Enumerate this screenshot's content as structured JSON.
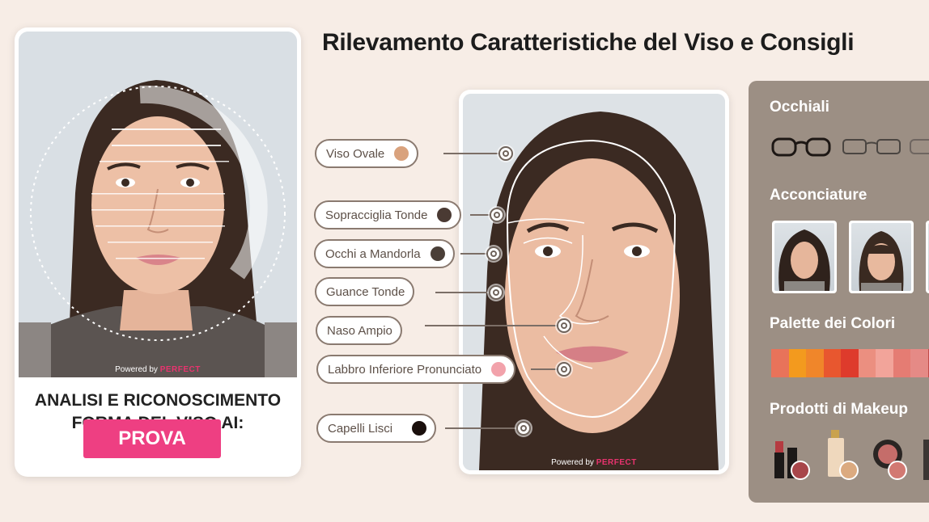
{
  "title": "Rilevamento Caratteristiche del Viso e Consigli",
  "left_card": {
    "heading_line1": "ANALISI E RICONOSCIMENTO",
    "heading_line2": "FORMA DEL VISO AI:",
    "cta_label": "PROVA",
    "powered_prefix": "Powered by",
    "powered_brand": "PERFECT"
  },
  "features": [
    {
      "label": "Viso Ovale",
      "color": "#d9a27d"
    },
    {
      "label": "Sopracciglia Tonde",
      "color": "#4a3a33"
    },
    {
      "label": "Occhi a Mandorla",
      "color": "#4a3f38"
    },
    {
      "label": "Guance Tonde",
      "color": ""
    },
    {
      "label": "Naso Ampio",
      "color": ""
    },
    {
      "label": "Labbro Inferiore Pronunciato",
      "color": "#f2a2ab"
    },
    {
      "label": "Capelli Lisci",
      "color": "#1a0f0c"
    }
  ],
  "center_photo": {
    "powered_prefix": "Powered by",
    "powered_brand": "PERFECT"
  },
  "panel": {
    "glasses_title": "Occhiali",
    "hair_title": "Acconciature",
    "palette_title": "Palette dei Colori",
    "makeup_title": "Prodotti di Makeup",
    "palette_colors": [
      "#e8735a",
      "#f39a1e",
      "#f0862a",
      "#e8572f",
      "#de3b2c",
      "#eb8f80",
      "#f2a49a",
      "#e57c73",
      "#e58a86",
      "#c24b48"
    ],
    "product_icons": [
      "lipstick-icon",
      "foundation-icon",
      "blush-icon",
      "palette-icon"
    ]
  },
  "colors": {
    "accent": "#ee3f82",
    "panel_bg": "#9c8f84",
    "page_bg": "#f7ede6"
  }
}
